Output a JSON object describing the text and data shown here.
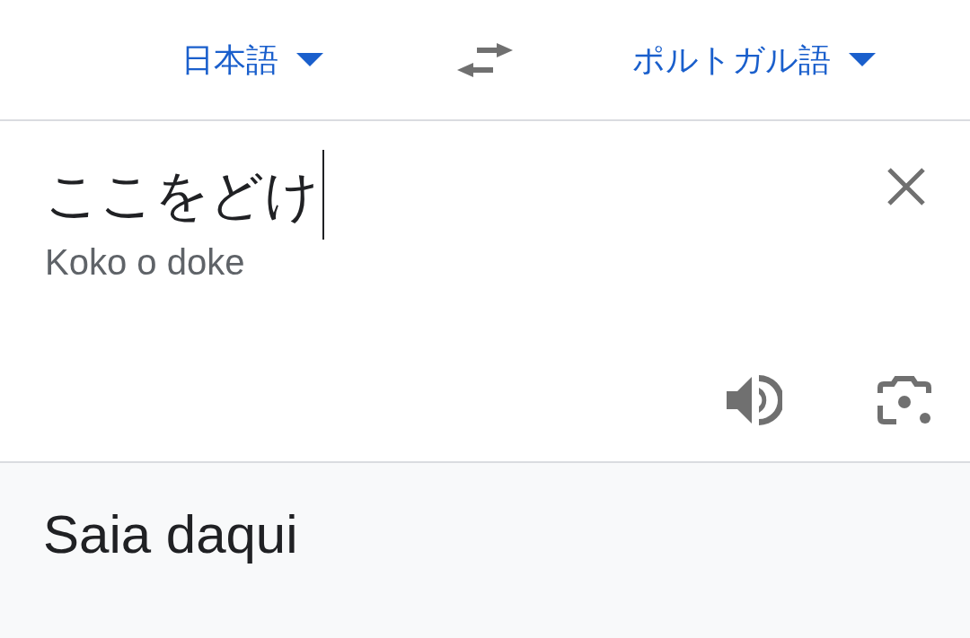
{
  "languages": {
    "source": {
      "label": "日本語"
    },
    "target": {
      "label": "ポルトガル語"
    }
  },
  "input": {
    "value": "ここをどけ",
    "romanization": "Koko o doke"
  },
  "output": {
    "text": "Saia daqui"
  }
}
